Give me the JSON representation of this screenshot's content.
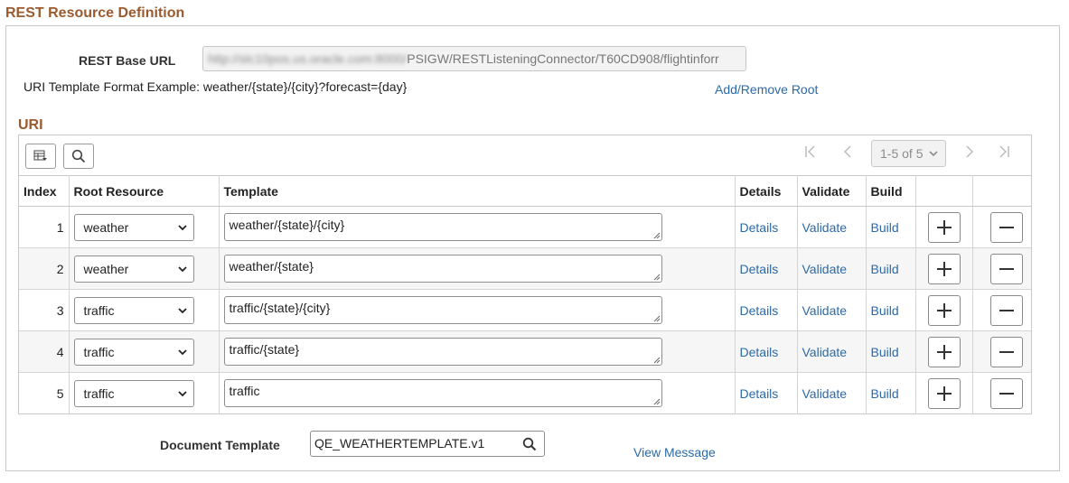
{
  "section_title": "REST Resource Definition",
  "base_url": {
    "label": "REST Base URL",
    "value_blurred": "http://slc10pos.us.oracle.com:8000/",
    "value_visible": "PSIGW/RESTListeningConnector/T60CD908/flightinforr"
  },
  "uri_example": "URI Template Format Example: weather/{state}/{city}?forecast={day}",
  "add_remove_root": "Add/Remove Root",
  "uri_section_title": "URI",
  "pager": {
    "first_glyph": "|<",
    "prev_glyph": "<",
    "range": "1-5 of 5",
    "next_glyph": ">",
    "last_glyph": ">|"
  },
  "columns": {
    "index": "Index",
    "root_resource": "Root Resource",
    "template": "Template",
    "details": "Details",
    "validate": "Validate",
    "build": "Build"
  },
  "rows": [
    {
      "index": "1",
      "root": "weather",
      "template": "weather/{state}/{city}",
      "details": "Details",
      "validate": "Validate",
      "build": "Build"
    },
    {
      "index": "2",
      "root": "weather",
      "template": "weather/{state}",
      "details": "Details",
      "validate": "Validate",
      "build": "Build"
    },
    {
      "index": "3",
      "root": "traffic",
      "template": "traffic/{state}/{city}",
      "details": "Details",
      "validate": "Validate",
      "build": "Build"
    },
    {
      "index": "4",
      "root": "traffic",
      "template": "traffic/{state}",
      "details": "Details",
      "validate": "Validate",
      "build": "Build"
    },
    {
      "index": "5",
      "root": "traffic",
      "template": "traffic",
      "details": "Details",
      "validate": "Validate",
      "build": "Build"
    }
  ],
  "document_template": {
    "label": "Document Template",
    "value": "QE_WEATHERTEMPLATE.v1"
  },
  "view_message": "View Message",
  "icons": {
    "grid_options": "grid-options-icon",
    "find": "search-icon",
    "first": "first-page-icon",
    "prev": "previous-page-icon",
    "next": "next-page-icon",
    "last": "last-page-icon",
    "dropdown": "chevron-down-icon",
    "add_row": "plus-icon",
    "delete_row": "minus-icon",
    "lookup": "search-icon"
  },
  "colors": {
    "section_title": "#9b5a2e",
    "link": "#2b6aa8",
    "alt_row": "#f6f6f6",
    "border": "#c8c8c8"
  }
}
